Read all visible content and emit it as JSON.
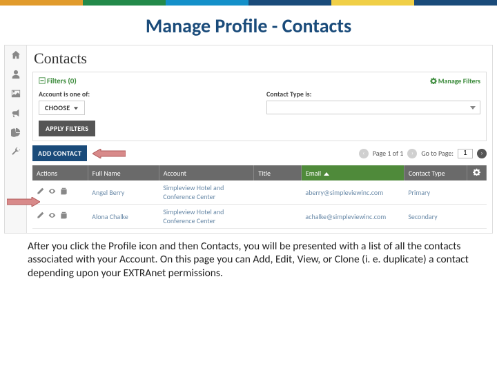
{
  "stripe_colors": [
    "#e19b2c",
    "#238a4a",
    "#1490c9",
    "#1a4b7a",
    "#f0cf47",
    "#1a4b7a"
  ],
  "slide_title": "Manage Profile - Contacts",
  "sidenav": {
    "items": [
      {
        "name": "home-icon"
      },
      {
        "name": "user-icon"
      },
      {
        "name": "image-icon"
      },
      {
        "name": "bullhorn-icon"
      },
      {
        "name": "piechart-icon"
      },
      {
        "name": "wrench-icon"
      }
    ]
  },
  "page_heading": "Contacts",
  "filters_panel": {
    "title": "Filters (0)",
    "manage_label": "Manage Filters",
    "account_label": "Account is one of:",
    "choose_label": "CHOOSE",
    "contact_type_label": "Contact Type is:",
    "apply_label": "APPLY FILTERS"
  },
  "toolbar": {
    "add_contact_label": "ADD CONTACT"
  },
  "pagination": {
    "page_text": "Page 1 of 1",
    "goto_label": "Go to Page:",
    "goto_value": "1"
  },
  "columns": {
    "actions": "Actions",
    "full_name": "Full Name",
    "account": "Account",
    "title": "Title",
    "email": "Email",
    "contact_type": "Contact Type"
  },
  "rows": [
    {
      "full_name": "Angel Berry",
      "account": "Simpleview Hotel and Conference Center",
      "title": "",
      "email": "aberry@simpleviewinc.com",
      "contact_type": "Primary"
    },
    {
      "full_name": "Alona Chalke",
      "account": "Simpleview Hotel and Conference Center",
      "title": "",
      "email": "achalke@simpleviewinc.com",
      "contact_type": "Secondary"
    }
  ],
  "caption": "After you click the Profile icon and then Contacts, you will be presented with a list of all the contacts associated with your Account. On this page you can Add, Edit, View, or Clone (i. e. duplicate) a contact depending upon your EXTRAnet permissions."
}
